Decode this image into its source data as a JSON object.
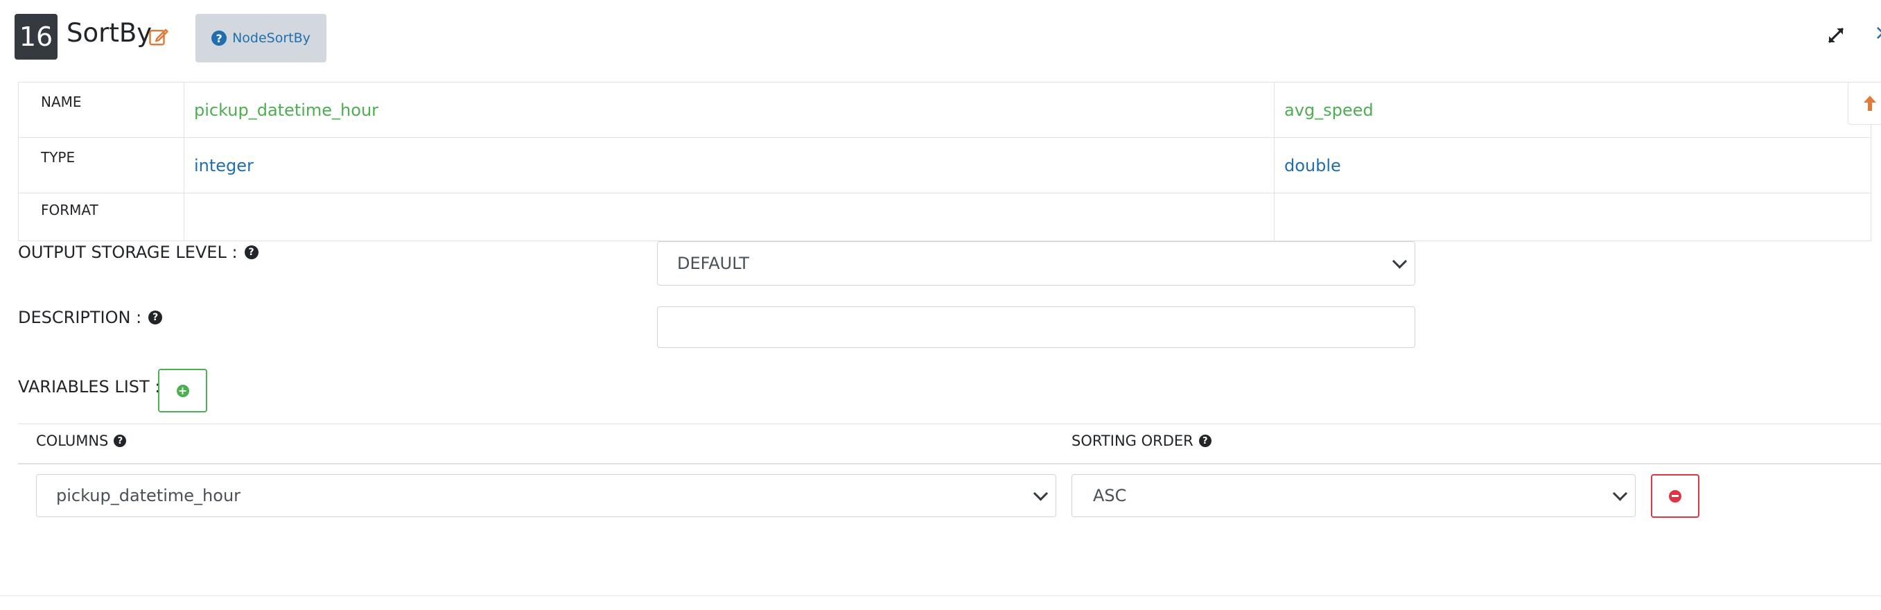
{
  "node": {
    "number": "16",
    "title": "SortBy",
    "help_label": "NodeSortBy",
    "edit_icon": "pencil-square-icon",
    "expand_icon": "expand-arrows-icon",
    "accent_color": "#e07b39"
  },
  "schema": {
    "row_labels": [
      "NAME",
      "TYPE",
      "FORMAT"
    ],
    "columns": [
      {
        "name": "pickup_datetime_hour",
        "type": "integer",
        "format": ""
      },
      {
        "name": "avg_speed",
        "type": "double",
        "format": ""
      }
    ],
    "name_color": "#4caf50",
    "type_color": "#1f6fb0"
  },
  "form": {
    "storage_label": "OUTPUT STORAGE LEVEL :",
    "storage_value": "DEFAULT",
    "description_label": "DESCRIPTION :",
    "description_value": "",
    "variables_label": "VARIABLES LIST :"
  },
  "variables_table": {
    "headers": {
      "columns": "COLUMNS",
      "sorting_order": "SORTING ORDER"
    },
    "rows": [
      {
        "column": "pickup_datetime_hour",
        "order": "ASC"
      }
    ]
  }
}
